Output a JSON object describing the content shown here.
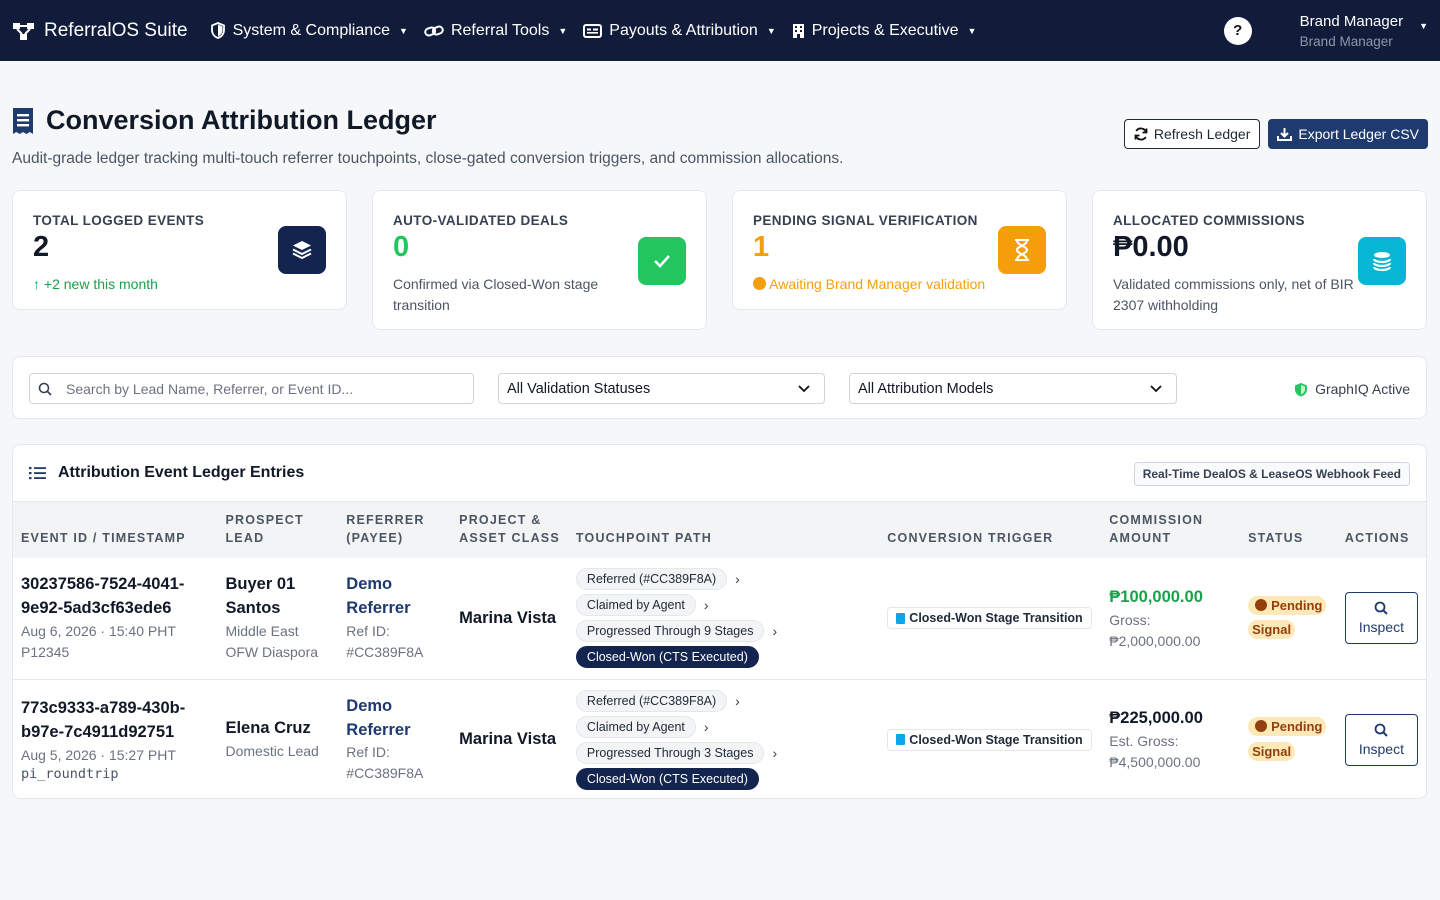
{
  "nav": {
    "brand": "ReferralOS Suite",
    "items": [
      {
        "label": "System & Compliance",
        "icon": "shield-icon"
      },
      {
        "label": "Referral Tools",
        "icon": "link-icon"
      },
      {
        "label": "Payouts & Attribution",
        "icon": "id-card-icon"
      },
      {
        "label": "Projects & Executive",
        "icon": "building-icon"
      }
    ],
    "help": "?",
    "user_name": "Brand Manager",
    "user_role": "Brand Manager"
  },
  "page": {
    "title": "Conversion Attribution Ledger",
    "subtitle": "Audit-grade ledger tracking multi-touch referrer touchpoints, close-gated conversion triggers, and commission allocations.",
    "refresh_label": "Refresh Ledger",
    "export_label": "Export Ledger CSV"
  },
  "cards": [
    {
      "label": "TOTAL LOGGED EVENTS",
      "value": "2",
      "note": "+2 new this month",
      "color": "#1e3a6e"
    },
    {
      "label": "AUTO-VALIDATED DEALS",
      "value": "0",
      "note": "Confirmed via Closed-Won stage transition",
      "color": "#22c55e"
    },
    {
      "label": "PENDING SIGNAL VERIFICATION",
      "value": "1",
      "note": "Awaiting Brand Manager validation",
      "color": "#f59e0b"
    },
    {
      "label": "ALLOCATED COMMISSIONS",
      "value": "₱0.00",
      "note": "Validated commissions only, net of BIR 2307 withholding",
      "color": "#06b6d4"
    }
  ],
  "filters": {
    "search_placeholder": "Search by Lead Name, Referrer, or Event ID...",
    "status_select": "All Validation Statuses",
    "model_select": "All Attribution Models",
    "graphiq": "GraphIQ Active"
  },
  "ledger": {
    "title": "Attribution Event Ledger Entries",
    "feed_badge": "Real-Time DealOS & LeaseOS Webhook Feed",
    "columns": [
      "EVENT ID / TIMESTAMP",
      "PROSPECT LEAD",
      "REFERRER (PAYEE)",
      "PROJECT & ASSET CLASS",
      "TOUCHPOINT PATH",
      "CONVERSION TRIGGER",
      "COMMISSION AMOUNT",
      "STATUS",
      "ACTIONS"
    ],
    "rows": [
      {
        "event_id": "30237586-7524-4041-9e92-5ad3cf63ede6",
        "timestamp": "Aug 6, 2026 · 15:40 PHT",
        "ref_code": "P12345",
        "lead": "Buyer 01 Santos",
        "lead_type": "Middle East OFW Diaspora",
        "referrer": "Demo Referrer",
        "ref_id": "Ref ID: #CC389F8A",
        "project": "Marina Vista",
        "path": [
          "Referred (#CC389F8A)",
          "Claimed by Agent",
          "Progressed Through 9 Stages",
          "Closed-Won (CTS Executed)"
        ],
        "trigger": "Closed-Won Stage Transition",
        "amount": "₱100,000.00",
        "amount_color": "#16a34a",
        "gross_label": "Gross:",
        "gross": "₱2,000,000.00",
        "status": "Pending Signal",
        "action": "Inspect"
      },
      {
        "event_id": "773c9333-a789-430b-b97e-7c4911d92751",
        "timestamp": "Aug 5, 2026 · 15:27 PHT",
        "ref_code": "pi_roundtrip",
        "lead": "Elena Cruz",
        "lead_type": "Domestic Lead",
        "referrer": "Demo Referrer",
        "ref_id": "Ref ID: #CC389F8A",
        "project": "Marina Vista",
        "path": [
          "Referred (#CC389F8A)",
          "Claimed by Agent",
          "Progressed Through 3 Stages",
          "Closed-Won (CTS Executed)"
        ],
        "trigger": "Closed-Won Stage Transition",
        "amount": "₱225,000.00",
        "amount_color": "#111827",
        "gross_label": "Est. Gross:",
        "gross": "₱4,500,000.00",
        "status": "Pending Signal",
        "action": "Inspect"
      }
    ]
  }
}
